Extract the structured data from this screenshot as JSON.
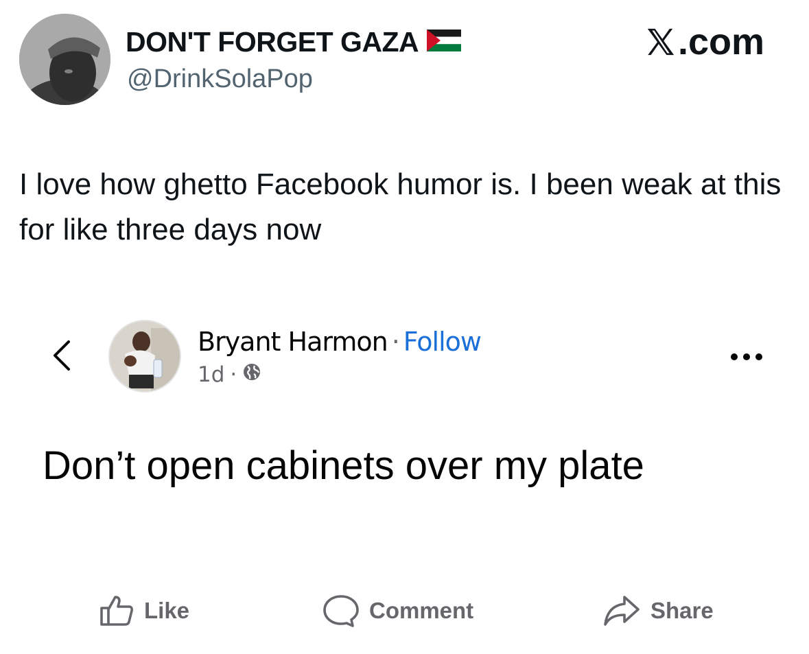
{
  "tweet": {
    "display_name": "DON'T FORGET GAZA",
    "flag_icon": "palestine-flag-icon",
    "handle": "@DrinkSolaPop",
    "watermark": ".com",
    "text": "I love how ghetto Facebook humor is. I been weak at this for like three days now"
  },
  "facebook_post": {
    "author": "Bryant Harmon",
    "separator": "·",
    "follow_label": "Follow",
    "time": "1d",
    "time_separator": "·",
    "privacy_icon": "globe-icon",
    "text": "Don’t open cabinets over my plate",
    "actions": {
      "like": "Like",
      "comment": "Comment",
      "share": "Share"
    }
  },
  "colors": {
    "follow_blue": "#1a6fd8",
    "secondary_gray": "#65676b",
    "handle_gray": "#536471",
    "flag_red": "#ce1126",
    "flag_green": "#007a3d"
  }
}
